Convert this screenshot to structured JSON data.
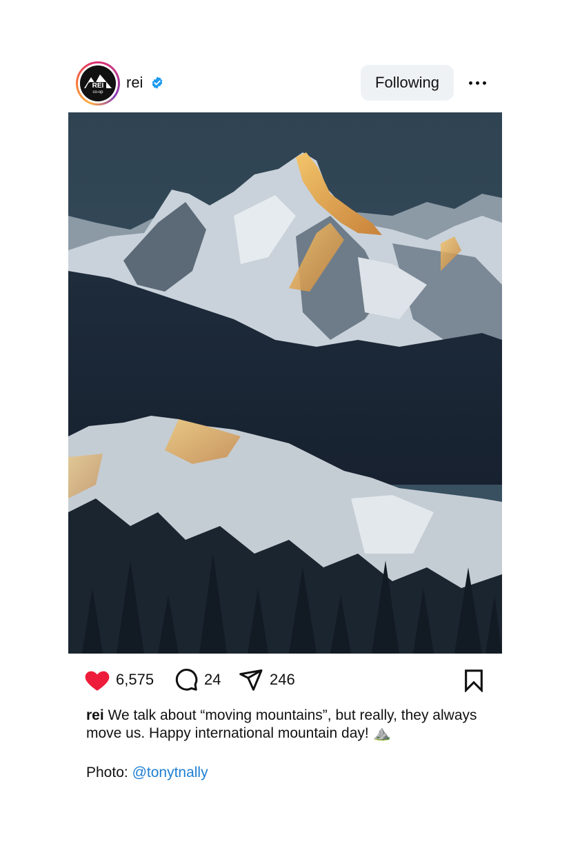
{
  "post": {
    "username": "rei",
    "avatar_logo_text": "REI co-op",
    "verified_icon": "verified-badge-icon",
    "follow_label": "Following",
    "more_icon": "more-options-icon"
  },
  "image": {
    "subject": "snow-covered mountain peaks at sunset"
  },
  "actions": {
    "likes": "6,575",
    "comments": "24",
    "shares": "246",
    "like_icon": "heart-filled-icon",
    "comment_icon": "comment-icon",
    "share_icon": "send-icon",
    "save_icon": "bookmark-icon",
    "like_color": "#ed1c3a"
  },
  "caption": {
    "user": "rei",
    "text": "We talk about “moving mountains”, but really, they always move us. Happy international mountain day!",
    "emoji": "⛰️",
    "credit_prefix": "Photo: ",
    "credit_handle": "@tonytnally"
  },
  "colors": {
    "link": "#1e7fd3",
    "verified": "#1d9bf0",
    "button_bg": "#eff2f5"
  }
}
